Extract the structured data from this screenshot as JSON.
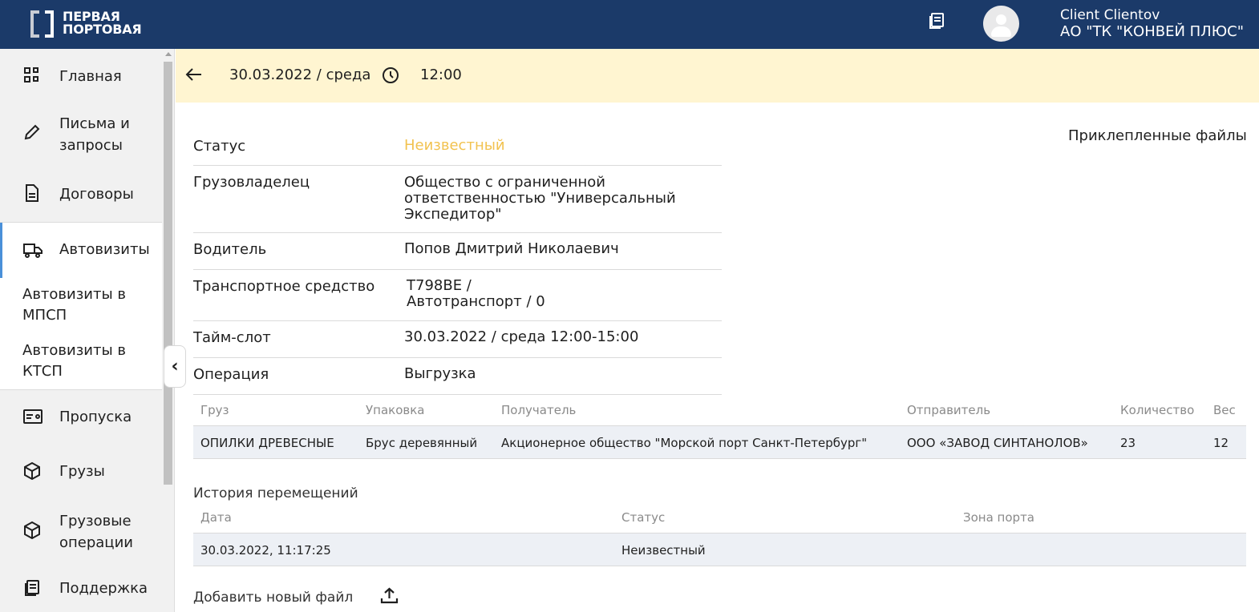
{
  "header": {
    "logo_line1": "ПЕРВАЯ",
    "logo_line2": "ПОРТОВАЯ",
    "user_name": "Client Clientov",
    "user_org": "АО \"ТК \"КОНВЕЙ ПЛЮС\""
  },
  "sidebar": {
    "items": [
      {
        "label": "Главная",
        "icon": "dashboard-icon"
      },
      {
        "label": "Письма и запросы",
        "icon": "pencil-icon"
      },
      {
        "label": "Договоры",
        "icon": "document-icon"
      },
      {
        "label": "Автовизиты",
        "icon": "truck-icon",
        "active": true
      },
      {
        "label": "Пропуска",
        "icon": "pass-card-icon"
      },
      {
        "label": "Грузы",
        "icon": "box-icon"
      },
      {
        "label": "Грузовые операции",
        "icon": "box-icon"
      },
      {
        "label": "Поддержка",
        "icon": "book-icon"
      }
    ],
    "submenu": [
      {
        "label": "Автовизиты в МПСП"
      },
      {
        "label": "Автовизиты в КТСП"
      }
    ],
    "collapse_glyph": "‹"
  },
  "topbar": {
    "date": "30.03.2022 / среда",
    "time": "12:00"
  },
  "details": {
    "attached_files_title": "Приклепленные файлы",
    "rows": [
      {
        "label": "Статус",
        "value": "Неизвестный"
      },
      {
        "label": "Грузовладелец",
        "value": "Общество с ограниченной ответственностью \"Универсальный Экспедитор\""
      },
      {
        "label": "Водитель",
        "value": "Попов Дмитрий Николаевич"
      },
      {
        "label": "Транспортное средство",
        "value_line1": "Т798ВЕ /",
        "value_line2": "Автотранспорт / 0"
      },
      {
        "label": "Тайм-слот",
        "value": "30.03.2022 / среда 12:00-15:00"
      },
      {
        "label": "Операция",
        "value": "Выгрузка"
      }
    ]
  },
  "cargo_table": {
    "headers": [
      "Груз",
      "Упаковка",
      "Получатель",
      "Отправитель",
      "Количество",
      "Вес"
    ],
    "rows": [
      [
        "ОПИЛКИ ДРЕВЕСНЫЕ",
        "Брус деревянный",
        "Акционерное общество \"Морской порт Санкт-Петербург\"",
        "ООО «ЗАВОД СИНТАНОЛОВ»",
        "23",
        "12"
      ]
    ]
  },
  "history": {
    "title": "История перемещений",
    "headers": [
      "Дата",
      "Статус",
      "Зона порта"
    ],
    "rows": [
      [
        "30.03.2022, 11:17:25",
        "Неизвестный",
        ""
      ]
    ]
  },
  "add_file_label": "Добавить новый файл",
  "colors": {
    "header_bg": "#1b3a69",
    "topbar_bg": "#fff5d1",
    "status_unknown": "#f2c24f",
    "active_accent": "#4a90d9",
    "table_row_bg": "#edf0f5"
  }
}
